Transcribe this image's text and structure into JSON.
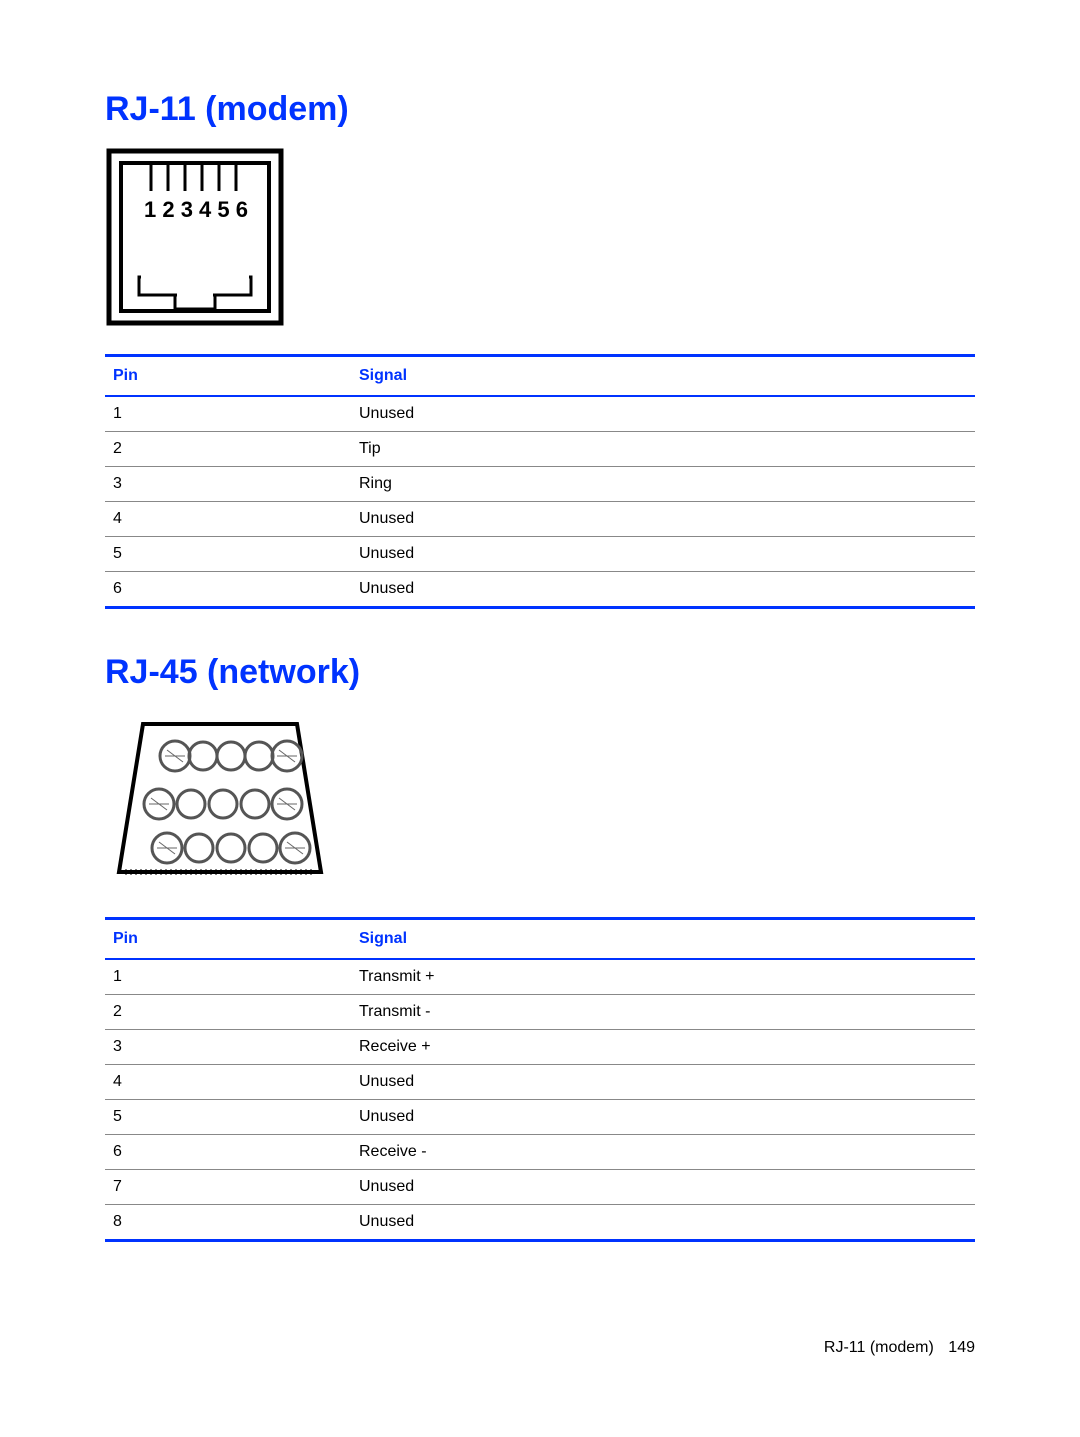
{
  "sections": [
    {
      "title": "RJ-11 (modem)",
      "headers": {
        "pin": "Pin",
        "signal": "Signal"
      },
      "rows": [
        {
          "pin": "1",
          "signal": "Unused"
        },
        {
          "pin": "2",
          "signal": "Tip"
        },
        {
          "pin": "3",
          "signal": "Ring"
        },
        {
          "pin": "4",
          "signal": "Unused"
        },
        {
          "pin": "5",
          "signal": "Unused"
        },
        {
          "pin": "6",
          "signal": "Unused"
        }
      ]
    },
    {
      "title": "RJ-45 (network)",
      "headers": {
        "pin": "Pin",
        "signal": "Signal"
      },
      "rows": [
        {
          "pin": "1",
          "signal": "Transmit +"
        },
        {
          "pin": "2",
          "signal": "Transmit -"
        },
        {
          "pin": "3",
          "signal": "Receive +"
        },
        {
          "pin": "4",
          "signal": "Unused"
        },
        {
          "pin": "5",
          "signal": "Unused"
        },
        {
          "pin": "6",
          "signal": "Receive -"
        },
        {
          "pin": "7",
          "signal": "Unused"
        },
        {
          "pin": "8",
          "signal": "Unused"
        }
      ]
    }
  ],
  "footer": {
    "label": "RJ-11 (modem)",
    "page": "149"
  }
}
